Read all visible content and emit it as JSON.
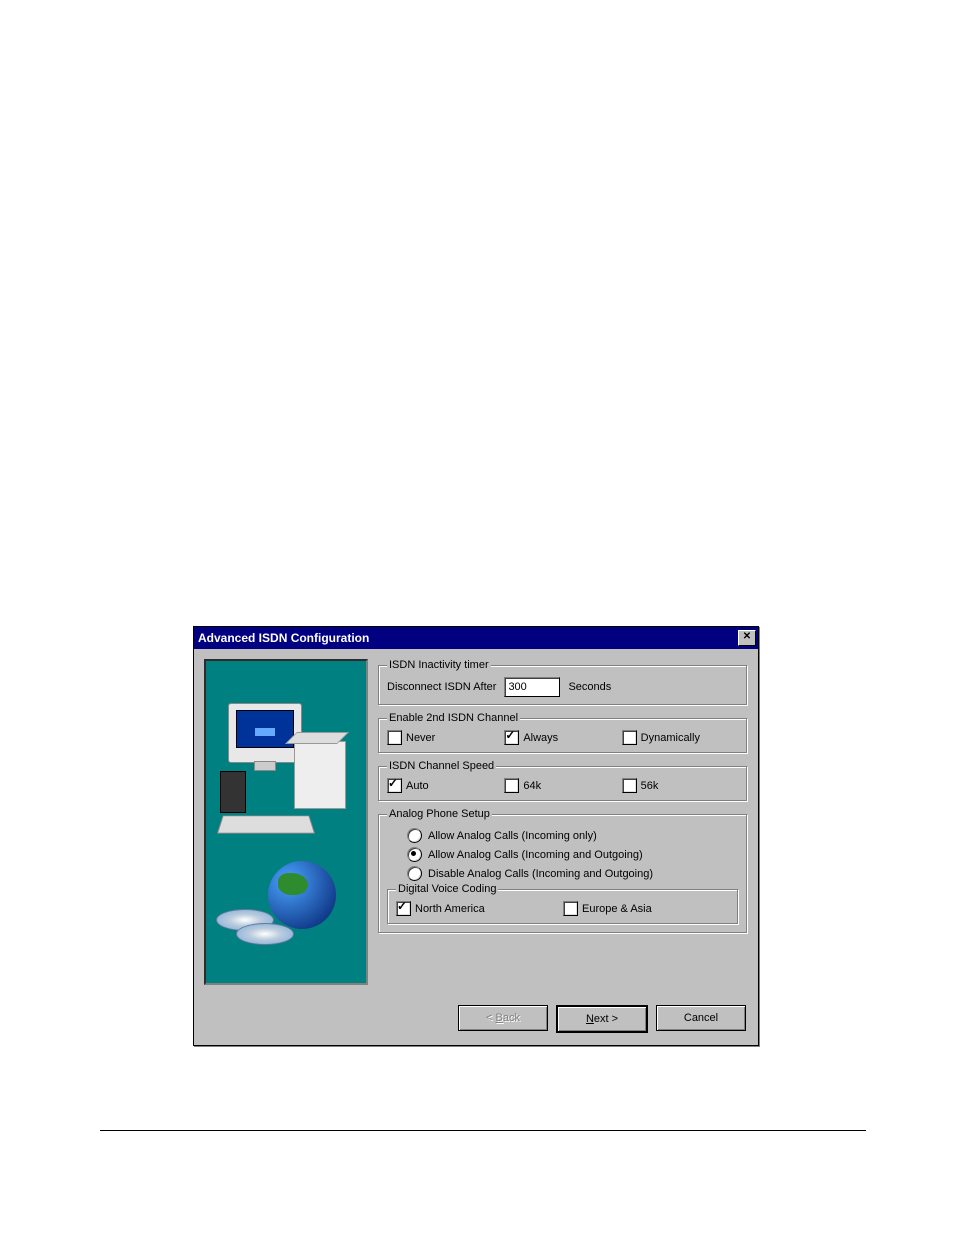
{
  "dialog": {
    "title": "Advanced ISDN Configuration",
    "groups": {
      "inactivity": {
        "legend": "ISDN Inactivity timer",
        "disconnect_label": "Disconnect ISDN After",
        "disconnect_value": "300",
        "seconds_label": "Seconds"
      },
      "second_channel": {
        "legend": "Enable 2nd ISDN Channel",
        "never": {
          "label": "Never",
          "checked": false
        },
        "always": {
          "label": "Always",
          "checked": true
        },
        "dynamically": {
          "label": "Dynamically",
          "checked": false
        }
      },
      "speed": {
        "legend": "ISDN Channel Speed",
        "auto": {
          "label": "Auto",
          "checked": true
        },
        "k64": {
          "label": "64k",
          "checked": false
        },
        "k56": {
          "label": "56k",
          "checked": false
        }
      },
      "analog": {
        "legend": "Analog Phone Setup",
        "opt_incoming": {
          "label": "Allow Analog Calls (Incoming only)",
          "checked": false
        },
        "opt_both": {
          "label": "Allow Analog Calls (Incoming and Outgoing)",
          "checked": true
        },
        "opt_disable": {
          "label": "Disable Analog Calls (Incoming and Outgoing)",
          "checked": false
        },
        "voice": {
          "legend": "Digital Voice Coding",
          "north_america": {
            "label": "North America",
            "checked": true
          },
          "europe_asia": {
            "label": "Europe & Asia",
            "checked": false
          }
        }
      }
    },
    "buttons": {
      "back": "< Back",
      "next": "Next >",
      "cancel": "Cancel"
    }
  }
}
